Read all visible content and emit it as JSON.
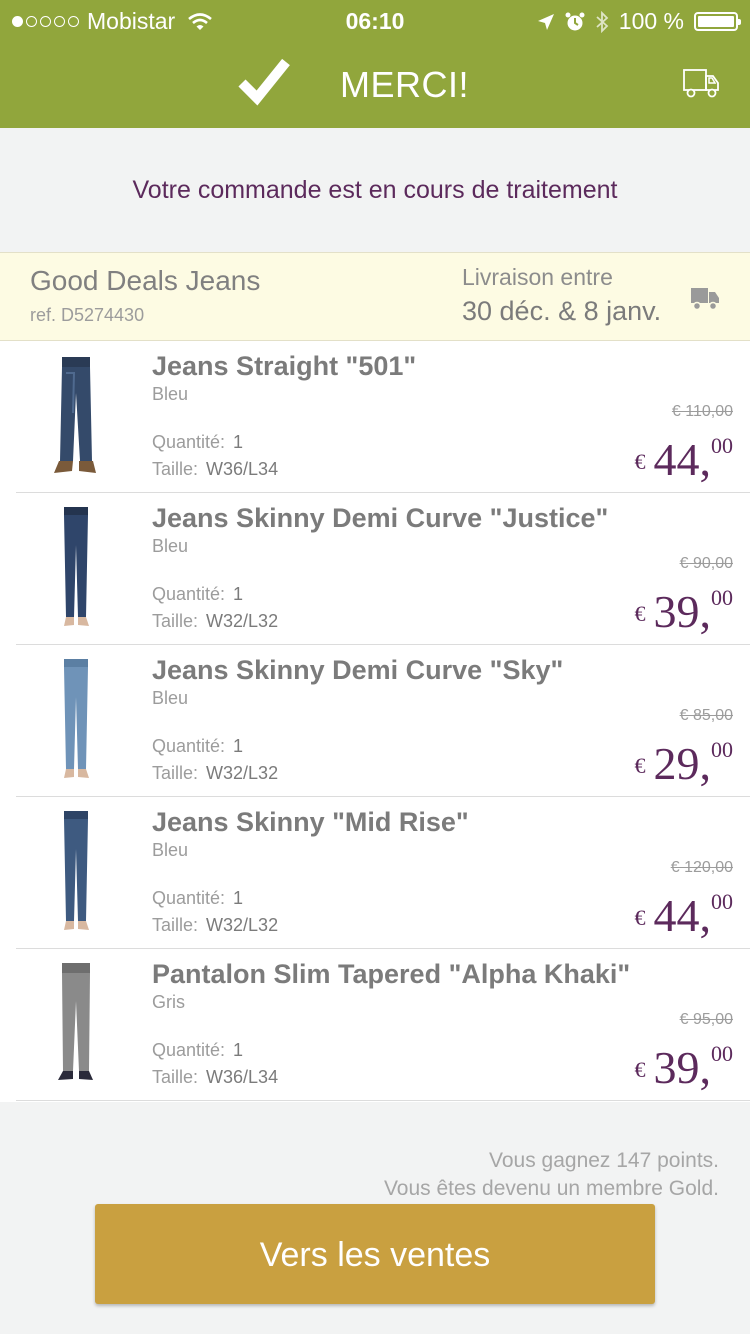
{
  "status_bar": {
    "carrier": "Mobistar",
    "time": "06:10",
    "battery": "100 %",
    "signal_dots_filled": 1
  },
  "header": {
    "title": "MERCI!",
    "background": "#91a63c"
  },
  "subtitle": "Votre commande est en cours de traitement",
  "seller": {
    "name": "Good Deals Jeans",
    "ref": "ref. D5274430",
    "delivery_label": "Livraison entre",
    "delivery_dates": "30 déc. & 8 janv."
  },
  "labels": {
    "quantity": "Quantité:",
    "size": "Taille:"
  },
  "items": [
    {
      "name": "Jeans Straight \"501\"",
      "color": "Bleu",
      "quantity": "1",
      "size": "W36/L34",
      "old_price": "€ 110,00",
      "currency": "€",
      "price_int": "44,",
      "price_dec": "00",
      "image": "dark-jeans-straight"
    },
    {
      "name": "Jeans Skinny Demi Curve \"Justice\"",
      "color": "Bleu",
      "quantity": "1",
      "size": "W32/L32",
      "old_price": "€ 90,00",
      "currency": "€",
      "price_int": "39,",
      "price_dec": "00",
      "image": "dark-skinny-jeans"
    },
    {
      "name": "Jeans Skinny Demi Curve \"Sky\"",
      "color": "Bleu",
      "quantity": "1",
      "size": "W32/L32",
      "old_price": "€ 85,00",
      "currency": "€",
      "price_int": "29,",
      "price_dec": "00",
      "image": "light-skinny-jeans"
    },
    {
      "name": "Jeans Skinny \"Mid Rise\"",
      "color": "Bleu",
      "quantity": "1",
      "size": "W32/L32",
      "old_price": "€ 120,00",
      "currency": "€",
      "price_int": "44,",
      "price_dec": "00",
      "image": "mid-skinny-jeans"
    },
    {
      "name": "Pantalon Slim Tapered \"Alpha Khaki\"",
      "color": "Gris",
      "quantity": "1",
      "size": "W36/L34",
      "old_price": "€ 95,00",
      "currency": "€",
      "price_int": "39,",
      "price_dec": "00",
      "image": "grey-trousers"
    }
  ],
  "points": {
    "line1": "Vous gagnez 147 points.",
    "line2": "Vous êtes devenu un membre Gold."
  },
  "cta": {
    "label": "Vers les ventes",
    "color": "#c9a040"
  },
  "colors": {
    "accent_purple": "#5c2a5c",
    "seller_bg": "#fdfbe3"
  }
}
